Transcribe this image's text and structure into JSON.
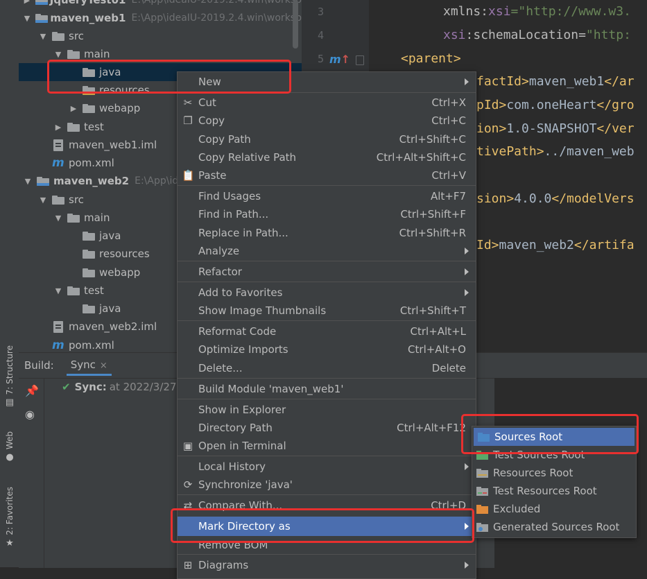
{
  "toolstrip": {
    "structure": "7: Structure",
    "web": "Web",
    "favorites": "2: Favorites"
  },
  "project": {
    "rows": [
      {
        "name": "JqueryTest01",
        "path": "E:\\App\\ideaIU-2019.2.4.win\\worksp"
      },
      {
        "name": "maven_web1",
        "path": "E:\\App\\ideaIU-2019.2.4.win\\worksp"
      },
      {
        "name": "src"
      },
      {
        "name": "main"
      },
      {
        "name": "java"
      },
      {
        "name": "resources"
      },
      {
        "name": "webapp"
      },
      {
        "name": "test"
      },
      {
        "name": "maven_web1.iml"
      },
      {
        "name": "pom.xml"
      },
      {
        "name": "maven_web2",
        "path": "E:\\App\\ide"
      },
      {
        "name": "src"
      },
      {
        "name": "main"
      },
      {
        "name": "java"
      },
      {
        "name": "resources"
      },
      {
        "name": "webapp"
      },
      {
        "name": "test"
      },
      {
        "name": "java"
      },
      {
        "name": "maven_web2.iml"
      },
      {
        "name": "pom.xml"
      }
    ]
  },
  "editor": {
    "lines": [
      "3",
      "4",
      "5"
    ],
    "code": [
      {
        "a": "xmlns:",
        "b": "xsi",
        "c": "=\"http://www.w3."
      },
      {
        "a": "xsi",
        "b": ":schemaLocation=",
        "c": "\"http:"
      },
      {
        "tag": "<parent>"
      },
      {
        "a": "factId>",
        "b": "maven_web1",
        "c": "</ar"
      },
      {
        "a": "pId>",
        "b": "com.oneHeart",
        "c": "</gro"
      },
      {
        "a": "ion>",
        "b": "1.0-SNAPSHOT",
        "c": "</ver"
      },
      {
        "a": "tivePath>",
        "b": "../maven_web",
        "c": ""
      },
      {
        "a": "sion>",
        "b": "4.0.0",
        "c": "</modelVers"
      },
      {
        "a": "Id>",
        "b": "maven_web2",
        "c": "</artifa"
      }
    ]
  },
  "build": {
    "label": "Build:",
    "tab": "Sync",
    "close": "×",
    "sync_label": "Sync:",
    "sync_time": "at 2022/3/27"
  },
  "context_menu": {
    "items": [
      {
        "label": "New",
        "shortcut": "",
        "sub": true
      },
      {
        "label": "Cut",
        "shortcut": "Ctrl+X",
        "icon": "✂"
      },
      {
        "label": "Copy",
        "shortcut": "Ctrl+C",
        "icon": "❐"
      },
      {
        "label": "Copy Path",
        "shortcut": "Ctrl+Shift+C"
      },
      {
        "label": "Copy Relative Path",
        "shortcut": "Ctrl+Alt+Shift+C"
      },
      {
        "label": "Paste",
        "shortcut": "Ctrl+V",
        "icon": "📋"
      },
      {
        "label": "Find Usages",
        "shortcut": "Alt+F7"
      },
      {
        "label": "Find in Path...",
        "shortcut": "Ctrl+Shift+F"
      },
      {
        "label": "Replace in Path...",
        "shortcut": "Ctrl+Shift+R"
      },
      {
        "label": "Analyze",
        "shortcut": "",
        "sub": true
      },
      {
        "label": "Refactor",
        "shortcut": "",
        "sub": true
      },
      {
        "label": "Add to Favorites",
        "shortcut": "",
        "sub": true
      },
      {
        "label": "Show Image Thumbnails",
        "shortcut": "Ctrl+Shift+T"
      },
      {
        "label": "Reformat Code",
        "shortcut": "Ctrl+Alt+L"
      },
      {
        "label": "Optimize Imports",
        "shortcut": "Ctrl+Alt+O"
      },
      {
        "label": "Delete...",
        "shortcut": "Delete"
      },
      {
        "label": "Build Module 'maven_web1'",
        "shortcut": ""
      },
      {
        "label": "Show in Explorer",
        "shortcut": ""
      },
      {
        "label": "Directory Path",
        "shortcut": "Ctrl+Alt+F12"
      },
      {
        "label": "Open in Terminal",
        "shortcut": "",
        "icon": "▣"
      },
      {
        "label": "Local History",
        "shortcut": "",
        "sub": true
      },
      {
        "label": "Synchronize 'java'",
        "shortcut": "",
        "icon": "⟳"
      },
      {
        "label": "Compare With...",
        "shortcut": "Ctrl+D",
        "icon": "⇄"
      },
      {
        "label": "Mark Directory as",
        "shortcut": "",
        "sub": true
      },
      {
        "label": "Remove BOM",
        "shortcut": ""
      },
      {
        "label": "Diagrams",
        "shortcut": "",
        "sub": true
      }
    ]
  },
  "submenu": {
    "items": [
      {
        "label": "Sources Root",
        "color": "#4a88c7"
      },
      {
        "label": "Test Sources Root",
        "color": "#59a869"
      },
      {
        "label": "Resources Root",
        "color": "#9da0a2"
      },
      {
        "label": "Test Resources Root",
        "color": "#9da0a2"
      },
      {
        "label": "Excluded",
        "color": "#e08b3b"
      },
      {
        "label": "Generated Sources Root",
        "color": "#9da0a2"
      }
    ]
  },
  "colors": {
    "highlight": "#4b6eaf",
    "annotation_red": "#e8302f",
    "selection": "#0d293e"
  }
}
